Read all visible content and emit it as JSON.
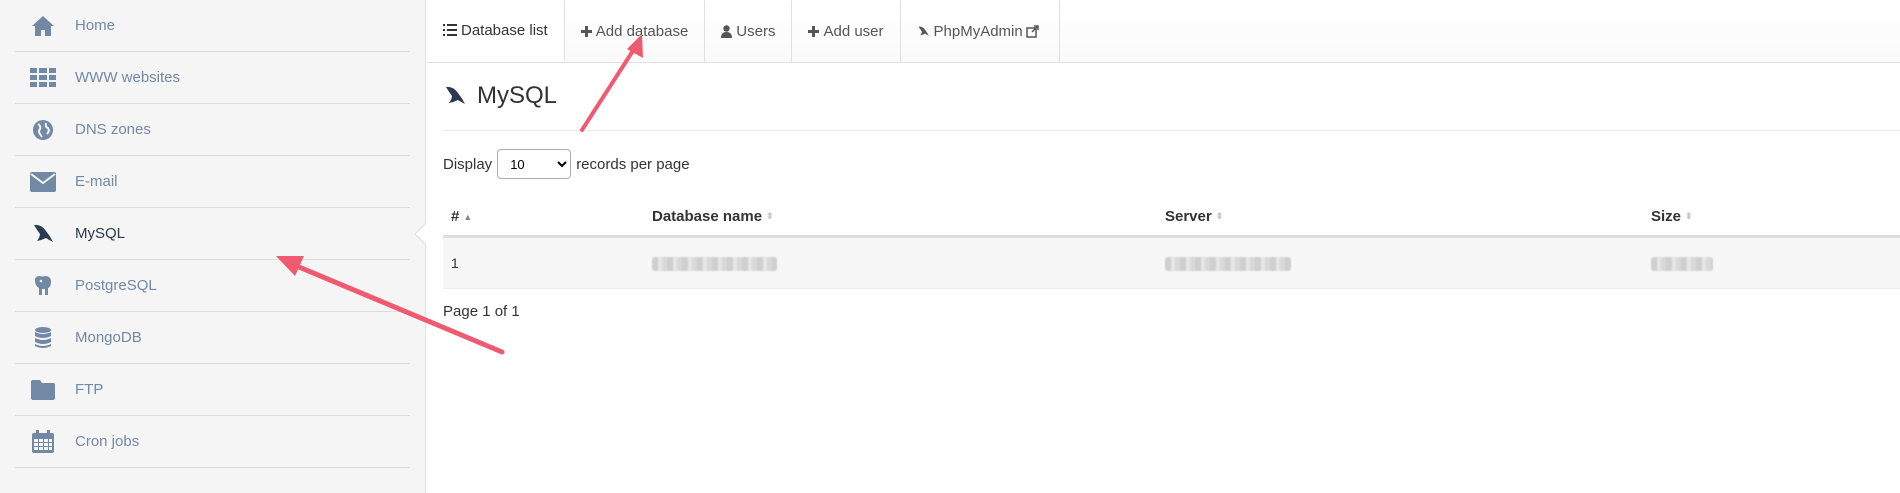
{
  "sidebar": {
    "items": [
      {
        "label": "Home",
        "icon": "home-icon"
      },
      {
        "label": "WWW websites",
        "icon": "grid-icon"
      },
      {
        "label": "DNS zones",
        "icon": "globe-icon"
      },
      {
        "label": "E-mail",
        "icon": "envelope-icon"
      },
      {
        "label": "MySQL",
        "icon": "dolphin-icon",
        "active": true
      },
      {
        "label": "PostgreSQL",
        "icon": "elephant-icon"
      },
      {
        "label": "MongoDB",
        "icon": "database-icon"
      },
      {
        "label": "FTP",
        "icon": "folder-icon"
      },
      {
        "label": "Cron jobs",
        "icon": "calendar-icon"
      }
    ]
  },
  "tabs": {
    "database_list": "Database list",
    "add_database": "Add database",
    "users": "Users",
    "add_user": "Add user",
    "phpmyadmin": "PhpMyAdmin"
  },
  "page": {
    "title": "MySQL",
    "display_prefix": "Display",
    "display_value": "10",
    "display_suffix": "records per page",
    "page_info": "Page 1 of 1"
  },
  "table": {
    "headers": [
      "#",
      "Database name",
      "Server",
      "Size"
    ],
    "rows": [
      {
        "num": "1"
      }
    ]
  },
  "colors": {
    "icon": "#7289a5",
    "active_icon": "#2b3a4f",
    "annotation_arrow": "#f05a6e"
  }
}
